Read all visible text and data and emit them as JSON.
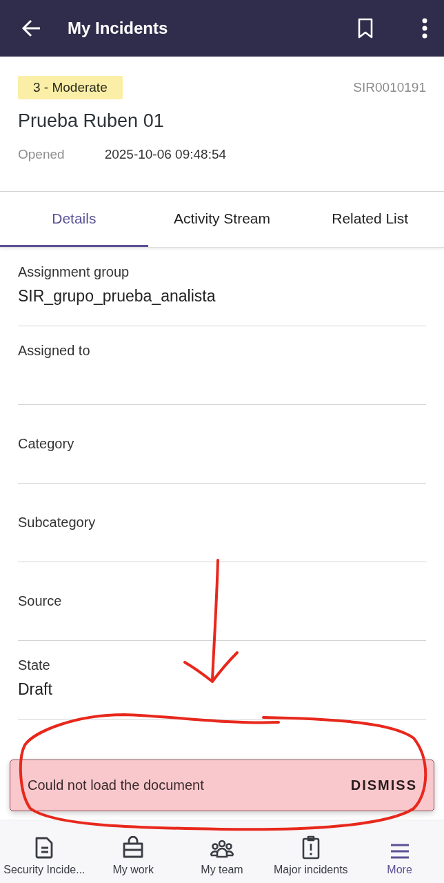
{
  "app_bar": {
    "title": "My Incidents"
  },
  "record": {
    "priority": "3 - Moderate",
    "number": "SIR0010191",
    "title": "Prueba Ruben 01",
    "opened_label": "Opened",
    "opened_value": "2025-10-06 09:48:54"
  },
  "tabs": [
    {
      "label": "Details",
      "selected": true
    },
    {
      "label": "Activity Stream",
      "selected": false
    },
    {
      "label": "Related List",
      "selected": false
    }
  ],
  "fields": [
    {
      "kind": "value",
      "label": "Assignment group",
      "value": "SIR_grupo_prueba_analista"
    },
    {
      "kind": "blank",
      "label": "Assigned to"
    },
    {
      "kind": "label",
      "label": "Category"
    },
    {
      "kind": "label",
      "label": "Subcategory"
    },
    {
      "kind": "label",
      "label": "Source"
    },
    {
      "kind": "value",
      "label": "State",
      "value": "Draft"
    }
  ],
  "toast": {
    "message": "Could not load the document",
    "action": "DISMISS"
  },
  "bottom_nav": [
    {
      "label": "Security Incide...",
      "selected": false
    },
    {
      "label": "My work",
      "selected": false
    },
    {
      "label": "My team",
      "selected": false
    },
    {
      "label": "Major incidents",
      "selected": false
    },
    {
      "label": "More",
      "selected": true
    }
  ]
}
